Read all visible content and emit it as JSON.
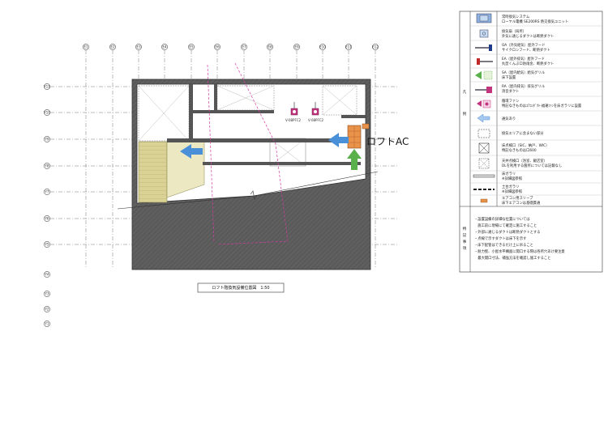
{
  "grid": {
    "columns": [
      "E1",
      "E2",
      "E3",
      "E4",
      "E5",
      "E6",
      "E7",
      "E8",
      "E9",
      "E10",
      "E11",
      "E12"
    ],
    "rows": [
      "Y11",
      "Y10",
      "Y9",
      "Y8",
      "Y7",
      "Y6",
      "Y5",
      "Y4",
      "Y3",
      "Y2",
      "Y1"
    ]
  },
  "plan": {
    "loft_ac_label": "ロフトAC",
    "vent_tag_1": "V-08PFC2",
    "vent_tag_2": "V-08PFC2",
    "title": "ロフト階換気設備位置図　1:50"
  },
  "legend": {
    "section_label_1": "凡",
    "section_label_2": "例",
    "items": [
      {
        "line1": "常時換気システム",
        "line2": "ローヤル電機 SE200RS 熱交換気ユニット"
      },
      {
        "line1": "換気扇（局所）",
        "line2": "外気に通じるダクトは断熱ダクト"
      },
      {
        "line1": "OA（外気給気）屋外フード",
        "line2": "サイクロンフード、断熱ダクト"
      },
      {
        "line1": "EA（屋外排気）屋外フード",
        "line2": "丸型くんぷロ防雨金、断熱ダクト"
      },
      {
        "line1": "SA（屋内給気）給気グリル",
        "line2": "床下設置"
      },
      {
        "line1": "RA（屋内排気）排気グリル",
        "line2": "消音ダクト"
      },
      {
        "line1": "循環ファン",
        "line2": "特記なきものはｴｱｺﾝﾀﾞｸﾄ-福運ﾌｧﾝを床ガラリに設置"
      },
      {
        "line1": "通気あり",
        "line2": ""
      },
      {
        "line1": "換気エリアに含まない部分",
        "line2": ""
      },
      {
        "line1": "床点検口（SIC、納戸、WIC）",
        "line2": "特記なきものは口600"
      },
      {
        "line1": "天井点検口（浴室、飯店室）",
        "line2": "DLを利用する箇所については記載なし"
      },
      {
        "line1": "床ガラリ",
        "line2": "※詳細図参照"
      },
      {
        "line1": "土台ガラリ",
        "line2": "※詳細図参照"
      },
      {
        "line1": "エアコン用スリーブ",
        "line2": "床下エアコンは基礎貫通"
      }
    ]
  },
  "notes": {
    "section_label": "特記事項",
    "lines": [
      "・設置設備の詳細な位置については",
      "　施工前に現場にて確定に施工すること",
      "・外部に通じるダクトは断熱ダクトとする",
      "・点線で示すダクトは床下を示す",
      "・床下配管はできるだけ上に吊ること",
      "・耐力壁、小屋水平構面に開口する際は各所穴あけ要注意",
      "　最大開口寸法、補強方法を確認し施工すること"
    ]
  },
  "colors": {
    "wall": "#585858",
    "ac_orange": "#e8924a",
    "arrow_blue": "#4a90d9",
    "arrow_green": "#5ab04a",
    "hatch_yellow": "#d9d294",
    "pink_line": "#d63aa3",
    "vent_pink": "#c2347e"
  }
}
